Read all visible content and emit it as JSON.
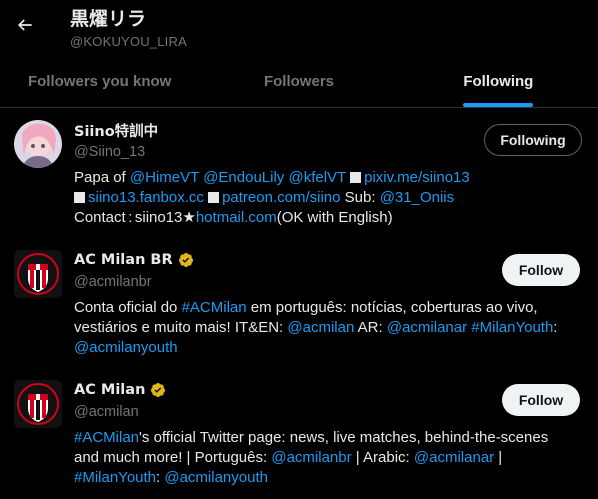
{
  "header": {
    "display_name": "黒燿リラ",
    "handle": "@KOKUYOU_LIRA"
  },
  "tabs": [
    {
      "label": "Followers you know"
    },
    {
      "label": "Followers"
    },
    {
      "label": "Following"
    }
  ],
  "active_tab": "Following",
  "users": [
    {
      "name": "Siino特訓中",
      "handle": "@Siino_13",
      "button": "Following",
      "bio": {
        "l1_pre": "Papa of ",
        "m1": "@HimeVT",
        "m2": "@EndouLily",
        "m3": "@kfelVT",
        "link1": "pixiv.me/siino13",
        "link2": "siino13.fanbox.cc",
        "link3": "patreon.com/siino",
        "sub_label": " Sub: ",
        "m4": "@31_Oniis",
        "contact_label": "Contact : siino13★",
        "contact_link": "hotmail.com",
        "contact_post": "(OK with English)"
      }
    },
    {
      "name": "AC Milan BR",
      "handle": "@acmilanbr",
      "button": "Follow",
      "bio": {
        "p1": "Conta oficial do ",
        "h1": "#ACMilan",
        "p2": " em português: notícias, coberturas ao vivo, vestiários e muito mais! IT&EN: ",
        "m1": "@acmilan",
        "p3": " AR: ",
        "m2": "@acmilanar",
        "h2": "#MilanYouth",
        "p4": ":",
        "m3": "@acmilanyouth"
      }
    },
    {
      "name": "AC Milan",
      "handle": "@acmilan",
      "button": "Follow",
      "bio": {
        "h1": "#ACMilan",
        "p1": "'s official Twitter page: news, live matches, behind-the-scenes and much more! | Português: ",
        "m1": "@acmilanbr",
        "p2": " | Arabic: ",
        "m2": "@acmilanar",
        "p3": " | ",
        "h2": "#MilanYouth",
        "p4": ": ",
        "m3": "@acmilanyouth"
      }
    }
  ],
  "colors": {
    "accent": "#1d9bf0",
    "verified_gold": "#e2b719",
    "milan_red": "#d1001c"
  },
  "icons": [
    "back-arrow-icon",
    "verified-badge-icon"
  ]
}
